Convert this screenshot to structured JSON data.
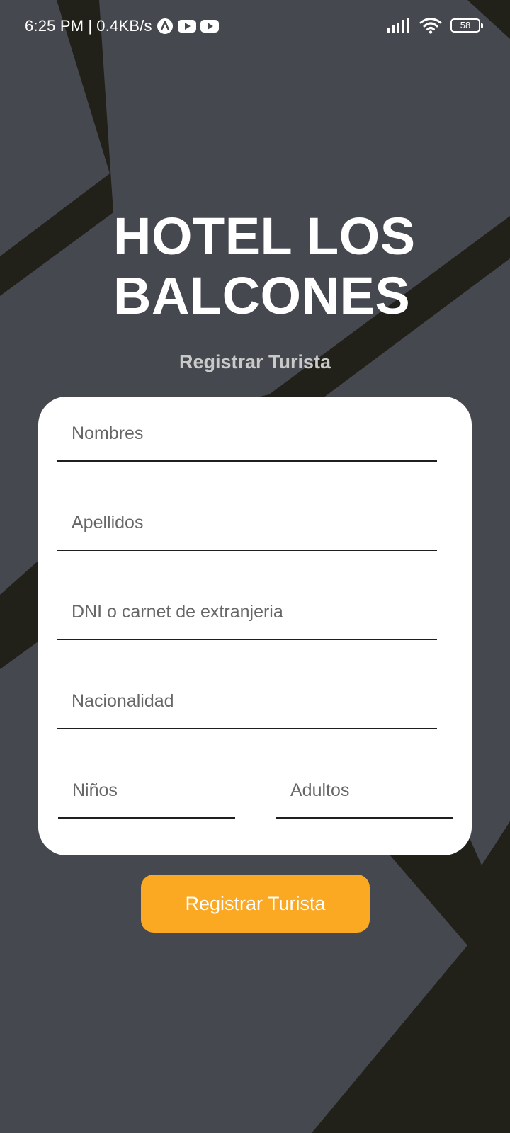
{
  "colors": {
    "background_dark": "#212019",
    "background_gray": "#45484e",
    "card": "#ffffff",
    "accent": "#fba822",
    "underline": "#1f1f1f",
    "placeholder": "#676767",
    "subtitle": "#c9c9c9"
  },
  "status_bar": {
    "time": "6:25 PM",
    "separator": "|",
    "network_speed": "0.4KB/s",
    "app_icons": [
      "app-a-icon",
      "youtube-icon",
      "youtube-icon"
    ],
    "signal_icon": "signal-icon",
    "wifi_icon": "wifi-icon",
    "battery": "58"
  },
  "header": {
    "title": "HOTEL LOS BALCONES",
    "subtitle": "Registrar Turista"
  },
  "form": {
    "nombres": {
      "value": "",
      "placeholder": "Nombres"
    },
    "apellidos": {
      "value": "",
      "placeholder": "Apellidos"
    },
    "dni": {
      "value": "",
      "placeholder": "DNI o carnet de extranjeria"
    },
    "nacionalidad": {
      "value": "",
      "placeholder": "Nacionalidad"
    },
    "ninos": {
      "value": "",
      "placeholder": "Niños"
    },
    "adultos": {
      "value": "",
      "placeholder": "Adultos"
    },
    "submit_label": "Registrar Turista"
  }
}
